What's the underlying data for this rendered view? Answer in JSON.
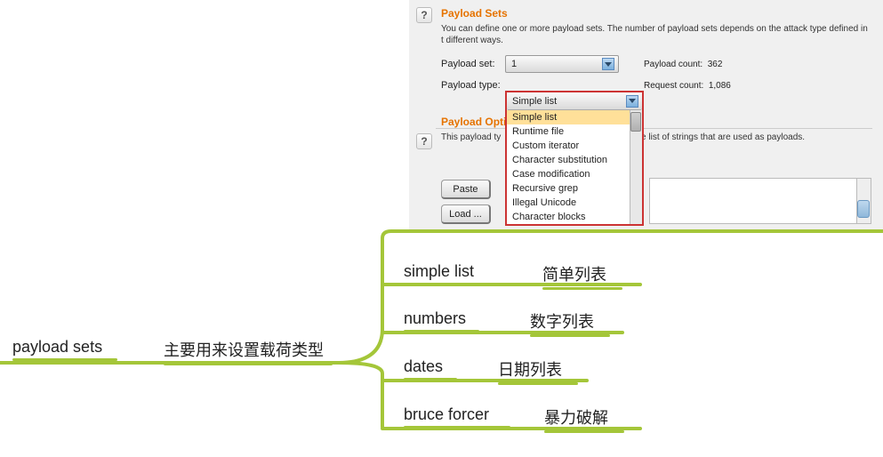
{
  "panel": {
    "section1": {
      "title": "Payload Sets",
      "desc": "You can define one or more payload sets. The number of payload sets depends on the attack type defined in t different ways.",
      "payload_set_label": "Payload set:",
      "payload_set_value": "1",
      "payload_count_label": "Payload count:",
      "payload_count_value": "362",
      "payload_type_label": "Payload type:",
      "payload_type_value": "Simple list",
      "request_count_label": "Request count:",
      "request_count_value": "1,086",
      "dropdown_items": [
        "Simple list",
        "Runtime file",
        "Custom iterator",
        "Character substitution",
        "Case modification",
        "Recursive grep",
        "Illegal Unicode",
        "Character blocks"
      ]
    },
    "section2": {
      "title": "Payload Opti",
      "desc_prefix": "This payload ty",
      "desc_suffix": "le list of strings that are used as payloads.",
      "btn_paste": "Paste",
      "btn_load": "Load ..."
    }
  },
  "notes": {
    "left1": "payload sets",
    "left2": "主要用来设置载荷类型",
    "rows": [
      {
        "en": "simple list",
        "zh": "简单列表"
      },
      {
        "en": "numbers",
        "zh": "数字列表"
      },
      {
        "en": "dates",
        "zh": "日期列表"
      },
      {
        "en": "bruce forcer",
        "zh": "暴力破解"
      }
    ]
  }
}
